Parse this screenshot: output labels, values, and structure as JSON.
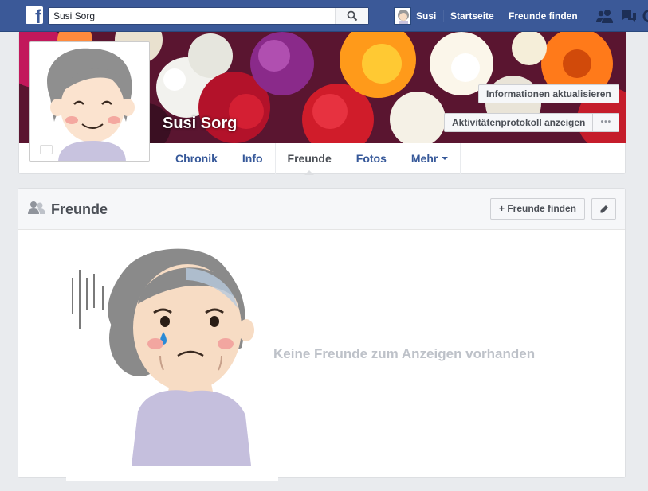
{
  "topbar": {
    "logo_letter": "f",
    "search_value": "Susi Sorg",
    "user_name": "Susi",
    "home_label": "Startseite",
    "find_friends_label": "Freunde finden"
  },
  "profile": {
    "name": "Susi Sorg",
    "update_info_label": "Informationen aktualisieren",
    "activity_log_label": "Aktivitätenprotokoll anzeigen",
    "more_dots": "•••",
    "tabs": [
      {
        "label": "Chronik"
      },
      {
        "label": "Info"
      },
      {
        "label": "Freunde"
      },
      {
        "label": "Fotos"
      },
      {
        "label": "Mehr"
      }
    ]
  },
  "friends_section": {
    "title": "Freunde",
    "find_friends_button": "+ Freunde finden",
    "empty_message": "Keine Freunde zum Anzeigen vorhanden"
  },
  "colors": {
    "topbar": "#3b5998",
    "link": "#365899",
    "empty_text": "#bec2c9"
  }
}
